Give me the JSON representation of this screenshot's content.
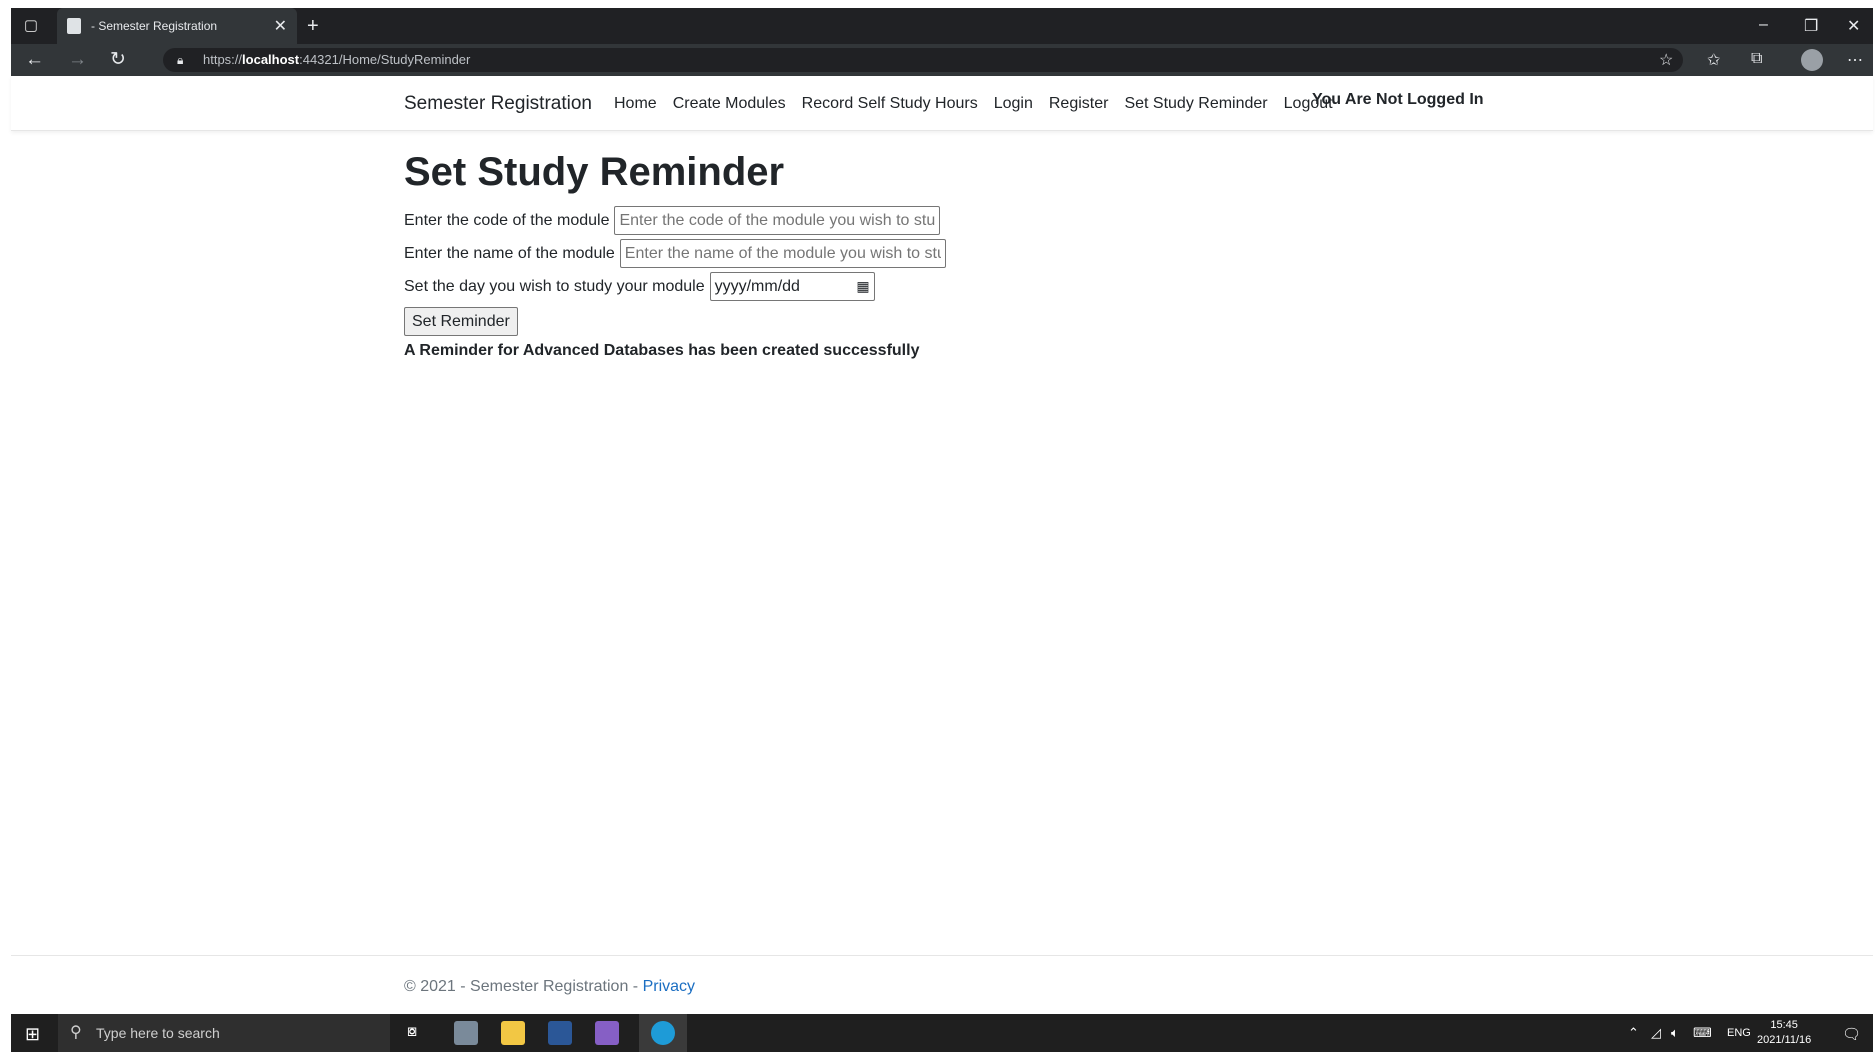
{
  "browser": {
    "tab_title": "- Semester Registration",
    "url_scheme": "https://",
    "url_host": "localhost",
    "url_rest": ":44321/Home/StudyReminder"
  },
  "navbar": {
    "brand": "Semester Registration",
    "links": [
      "Home",
      "Create Modules",
      "Record Self Study Hours",
      "Login",
      "Register",
      "Set Study Reminder",
      "Logout"
    ],
    "status": "You Are Not Logged In"
  },
  "form": {
    "title": "Set Study Reminder",
    "code_label": "Enter the code of the module",
    "code_placeholder": "Enter the code of the module you wish to stud",
    "name_label": "Enter the name of the module",
    "name_placeholder": "Enter the name of the module you wish to stuc",
    "day_label": "Set the day you wish to study your module",
    "day_placeholder": "yyyy/mm/dd",
    "submit_label": "Set Reminder",
    "result_message": "A Reminder for Advanced Databases has been created successfully"
  },
  "footer": {
    "text": "© 2021 - Semester Registration - ",
    "link": "Privacy"
  },
  "taskbar": {
    "search_placeholder": "Type here to search",
    "lang": "ENG",
    "time": "15:45",
    "date": "2021/11/16"
  },
  "colors": {
    "link": "#1b6ec2",
    "muted": "#6c757d",
    "text": "#212529"
  }
}
